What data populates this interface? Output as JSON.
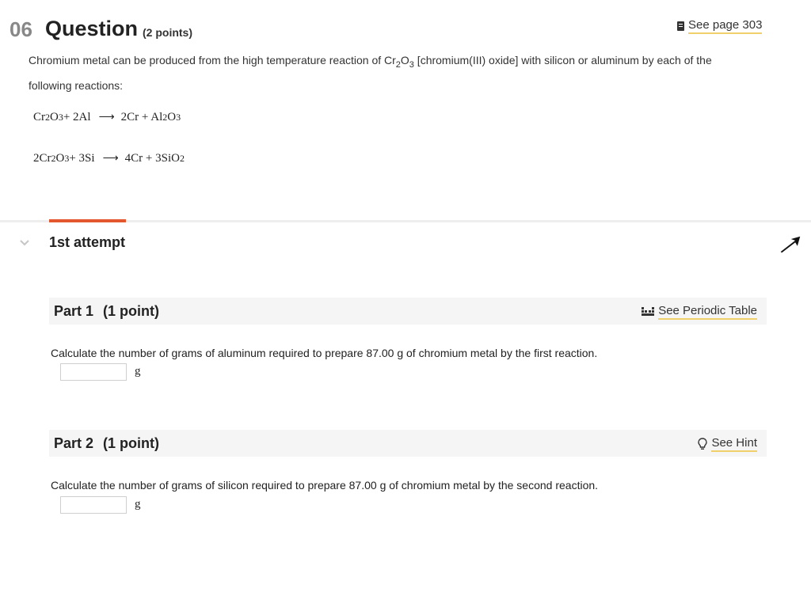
{
  "question": {
    "number": "06",
    "title": "Question",
    "points": "(2 points)",
    "see_page": {
      "label": "See page 303",
      "icon": "book-icon"
    },
    "intro_before": "Chromium metal can be produced from the high temperature reaction of Cr",
    "intro_sub1": "2",
    "intro_mid": "O",
    "intro_sub2": "3",
    "intro_after": " [chromium(III) oxide] with silicon or aluminum by each of the following reactions:"
  },
  "equations": [
    {
      "left": [
        "Cr",
        "2",
        "O",
        "3",
        " + 2Al"
      ],
      "right": [
        "2Cr + Al",
        "2",
        "O",
        "3"
      ]
    },
    {
      "left": [
        "2Cr",
        "2",
        "O",
        "3",
        " + 3Si"
      ],
      "right": [
        "4Cr + 3SiO",
        "2"
      ]
    }
  ],
  "attempt": {
    "label": "1st attempt",
    "accent_color": "#e4572e"
  },
  "parts": [
    {
      "title": "Part 1",
      "points": "(1 point)",
      "link_label": "See Periodic Table",
      "link_icon": "periodic-table-icon",
      "question": "Calculate the number of grams of aluminum required to prepare 87.00 g of chromium metal by the first reaction.",
      "answer_value": "",
      "unit": "g"
    },
    {
      "title": "Part 2",
      "points": "(1 point)",
      "link_label": "See Hint",
      "link_icon": "lightbulb-icon",
      "question": "Calculate the number of grams of silicon required to prepare 87.00 g of chromium metal by the second reaction.",
      "answer_value": "",
      "unit": "g"
    }
  ]
}
